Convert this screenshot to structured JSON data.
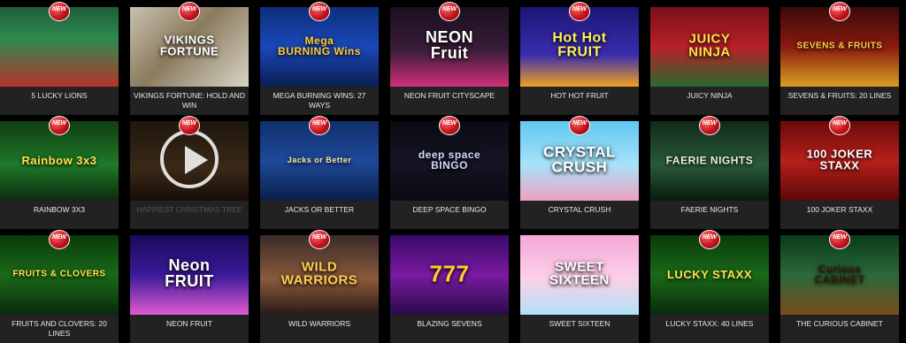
{
  "badge_label": "NEW",
  "games": [
    {
      "id": "5-lucky-lions",
      "caption": "5 LUCKY LIONS",
      "art": "",
      "new": true,
      "bg": "linear-gradient(180deg,#1f5d3a 0%,#2e8b4f 40%,#b5322a 100%)",
      "fg": "#ffd24a",
      "size": 11
    },
    {
      "id": "vikings-fortune",
      "caption": "VIKINGS FORTUNE: HOLD AND WIN",
      "art": "VIKINGS\nFORTUNE",
      "new": true,
      "bg": "linear-gradient(135deg,#c9c2b0 0%,#8b7b5e 45%,#d8d4c7 100%)",
      "fg": "#ffffff",
      "size": 13
    },
    {
      "id": "mega-burning-wins",
      "caption": "MEGA BURNING WINS: 27 WAYS",
      "art": "Mega\nBURNING Wins",
      "new": true,
      "bg": "linear-gradient(180deg,#0d2e7a 0%,#1a48b8 50%,#0a1d52 100%)",
      "fg": "#ffcc33",
      "size": 12
    },
    {
      "id": "neon-fruit-cityscape",
      "caption": "NEON FRUIT CITYSCAPE",
      "art": "NEON\nFruit",
      "new": true,
      "bg": "linear-gradient(180deg,#1a0f1f 0%,#3b1d3a 55%,#d2307a 100%)",
      "fg": "#ffffff",
      "size": 18
    },
    {
      "id": "hot-hot-fruit",
      "caption": "HOT HOT FRUIT",
      "art": "Hot Hot\nFRUIT",
      "new": true,
      "bg": "linear-gradient(180deg,#1b1674 0%,#3a2db0 60%,#f0a020 100%)",
      "fg": "#fff35a",
      "size": 16
    },
    {
      "id": "juicy-ninja",
      "caption": "JUICY NINJA",
      "art": "JUICY\nNINJA",
      "new": false,
      "bg": "linear-gradient(180deg,#7a1018 0%,#b8202a 50%,#2a6a2a 100%)",
      "fg": "#ffe14a",
      "size": 15
    },
    {
      "id": "sevens-fruits",
      "caption": "SEVENS & FRUITS: 20 LINES",
      "art": "SEVENS & FRUITS",
      "new": true,
      "bg": "linear-gradient(180deg,#3a0a08 0%,#8a1a10 50%,#d8a020 100%)",
      "fg": "#ffd24a",
      "size": 10
    },
    {
      "id": "rainbow-3x3",
      "caption": "RAINBOW 3X3",
      "art": "Rainbow 3x3",
      "new": true,
      "bg": "linear-gradient(180deg,#0f3d12 0%,#1f7a2a 55%,#0c2a0e 100%)",
      "fg": "#ffe14a",
      "size": 13
    },
    {
      "id": "happiest-christmas-tree",
      "caption": "HAPPIEST CHRISTMAS TREE",
      "art": "",
      "new": true,
      "bg": "linear-gradient(180deg,#3a2a1a 0%,#6a4a2a 60%,#2a1a10 100%)",
      "fg": "#ffffff",
      "size": 12,
      "dim": true,
      "play": true
    },
    {
      "id": "jacks-or-better",
      "caption": "JACKS OR BETTER",
      "art": "Jacks or Better",
      "new": true,
      "bg": "linear-gradient(180deg,#0f2f6a 0%,#1e4a9a 50%,#0a1f4a 100%)",
      "fg": "#ffe9a0",
      "size": 9
    },
    {
      "id": "deep-space-bingo",
      "caption": "DEEP SPACE BINGO",
      "art": "deep space\nBINGO",
      "new": true,
      "bg": "linear-gradient(180deg,#0a0a12 0%,#151525 50%,#0a0a12 100%)",
      "fg": "#d8d8ff",
      "size": 12
    },
    {
      "id": "crystal-crush",
      "caption": "CRYSTAL CRUSH",
      "art": "CRYSTAL\nCRUSH",
      "new": true,
      "bg": "linear-gradient(180deg,#5fc8f0 0%,#a8e2fa 55%,#f0a0c0 100%)",
      "fg": "#ffffff",
      "size": 17
    },
    {
      "id": "faerie-nights",
      "caption": "FAERIE NIGHTS",
      "art": "FAERIE NIGHTS",
      "new": true,
      "bg": "linear-gradient(180deg,#0f2a1a 0%,#2a5a3a 55%,#0a1a10 100%)",
      "fg": "#e8f0d8",
      "size": 12
    },
    {
      "id": "100-joker-staxx",
      "caption": "100 JOKER STAXX",
      "art": "100 JOKER\nSTAXX",
      "new": true,
      "bg": "linear-gradient(180deg,#6a0a0a 0%,#b8201a 50%,#5a0808 100%)",
      "fg": "#ffffff",
      "size": 13
    },
    {
      "id": "fruits-and-clovers",
      "caption": "FRUITS AND CLOVERS: 20 LINES",
      "art": "FRUITS & CLOVERS",
      "new": true,
      "bg": "linear-gradient(180deg,#0a3a0a 0%,#1a6a1a 50%,#0a2a0a 100%)",
      "fg": "#ffe14a",
      "size": 10
    },
    {
      "id": "neon-fruit",
      "caption": "NEON FRUIT",
      "art": "Neon\nFRUIT",
      "new": false,
      "bg": "linear-gradient(180deg,#1a0a5a 0%,#3a1a9a 50%,#e05ad0 100%)",
      "fg": "#ffffff",
      "size": 18
    },
    {
      "id": "wild-warriors",
      "caption": "WILD WARRIORS",
      "art": "WILD\nWARRIORS",
      "new": true,
      "bg": "linear-gradient(180deg,#3a2a2a 0%,#8a5a3a 55%,#2a1a1a 100%)",
      "fg": "#ffcc55",
      "size": 15
    },
    {
      "id": "blazing-sevens",
      "caption": "BLAZING SEVENS",
      "art": "777",
      "new": false,
      "bg": "linear-gradient(180deg,#3a0a6a 0%,#7a1aa0 50%,#2a0a4a 100%)",
      "fg": "#ffcc33",
      "size": 26
    },
    {
      "id": "sweet-sixteen",
      "caption": "SWEET SIXTEEN",
      "art": "SWEET\nSIXTEEN",
      "new": false,
      "bg": "linear-gradient(180deg,#f5a8d8 0%,#fcd0e8 55%,#b0e0f8 100%)",
      "fg": "#ffffff",
      "size": 15
    },
    {
      "id": "lucky-staxx",
      "caption": "LUCKY STAXX: 40 LINES",
      "art": "LUCKY STAXX",
      "new": true,
      "bg": "linear-gradient(180deg,#0a3a0a 0%,#1a6a1a 50%,#0a2a0a 100%)",
      "fg": "#ffe14a",
      "size": 13
    },
    {
      "id": "the-curious-cabinet",
      "caption": "THE CURIOUS CABINET",
      "art": "Curious\nCABINET",
      "new": true,
      "bg": "linear-gradient(180deg,#0a3a1a 0%,#2a6a3a 50%,#7a4a1a 100%)",
      "fg": "#3a1a0a",
      "size": 12
    }
  ]
}
